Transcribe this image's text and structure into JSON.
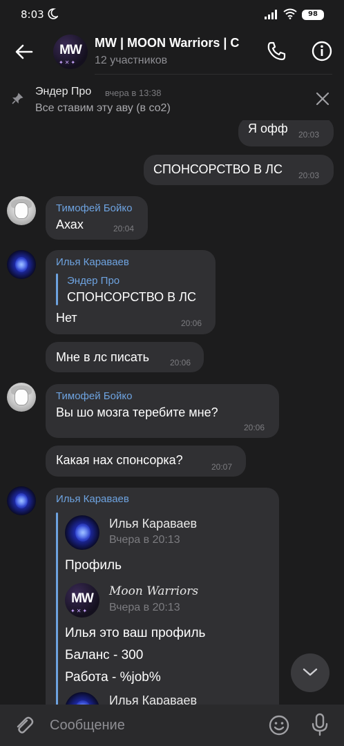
{
  "status": {
    "time": "8:03",
    "battery": "98"
  },
  "header": {
    "title": "MW | MOON Warriors | C",
    "subtitle": "12 участников",
    "avatar_text": "MW",
    "avatar_stars": "✦✕✦"
  },
  "pinned": {
    "author": "Эндер Про",
    "time": "вчера в 13:38",
    "text": "Все ставим эту аву (в со2)"
  },
  "messages": {
    "out1": {
      "text": "Я офф",
      "time": "20:03"
    },
    "out2": {
      "text": "СПОНСОРСТВО В ЛС",
      "time": "20:03"
    },
    "m1": {
      "author": "Тимофей Бойко",
      "text": "Ахах",
      "time": "20:04"
    },
    "m2": {
      "author": "Илья Караваев",
      "reply_author": "Эндер Про",
      "reply_text": "СПОНСОРСТВО В ЛС",
      "text": "Нет",
      "time": "20:06"
    },
    "m3": {
      "text": "Мне в лс писать",
      "time": "20:06"
    },
    "m4": {
      "author": "Тимофей Бойко",
      "text": "Вы шо мозга теребите мне?",
      "time": "20:06"
    },
    "m5": {
      "text": "Какая нах спонсорка?",
      "time": "20:07"
    },
    "m6": {
      "author": "Илья Караваев",
      "fwd1_author": "Илья Караваев",
      "fwd1_time": "Вчера в 20:13",
      "fwd1_text": "Профиль",
      "fwd2_author": "Moon Warriors",
      "fwd2_time": "Вчера в 20:13",
      "fwd2_avatar_text": "MW",
      "fwd2_line1": "Илья это ваш профиль",
      "fwd2_line2": "Баланс - 300",
      "fwd2_line3": "Работа - %job%",
      "fwd3_author": "Илья Караваев"
    }
  },
  "input": {
    "placeholder": "Сообщение"
  },
  "colors": {
    "background": "#1c1c1d",
    "bubble": "#303033",
    "accent": "#6ea3e0"
  },
  "icons": [
    "moon-icon",
    "signal-icon",
    "wifi-icon",
    "back-arrow-icon",
    "phone-icon",
    "info-icon",
    "pin-icon",
    "close-icon",
    "chevron-down-icon",
    "paperclip-icon",
    "emoji-icon",
    "microphone-icon"
  ]
}
